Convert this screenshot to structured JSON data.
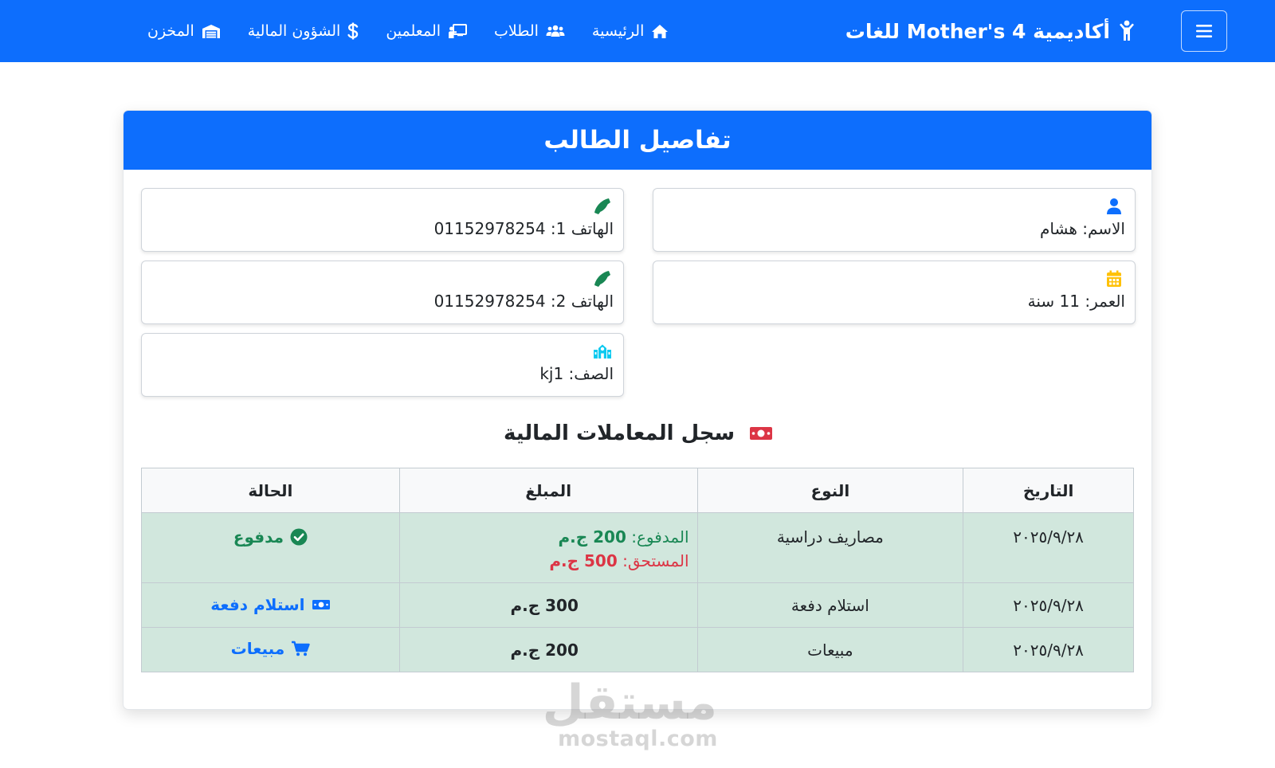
{
  "navbar": {
    "brand": "أكاديمية Mother's 4 للغات",
    "brand_icon": "child-icon",
    "links": [
      {
        "label": "الرئيسية",
        "icon": "home-icon"
      },
      {
        "label": "الطلاب",
        "icon": "users-icon"
      },
      {
        "label": "المعلمين",
        "icon": "chalkboard-teacher-icon"
      },
      {
        "label": "الشؤون المالية",
        "icon": "dollar-icon"
      },
      {
        "label": "المخزن",
        "icon": "warehouse-icon"
      }
    ],
    "toggler_icon": "hamburger-icon",
    "color": "#0d6efd"
  },
  "card": {
    "title": "تفاصيل الطالب",
    "fields": {
      "name": "الاسم: هشام",
      "age": "العمر: 11 سنة",
      "phone1": "الهاتف 1: 01152978254",
      "phone2": "الهاتف 2: 01152978254",
      "class": "الصف: kj1"
    },
    "field_icons": {
      "name": "user-icon",
      "age": "calendar-icon",
      "phone1": "phone-icon",
      "phone2": "phone-icon",
      "class": "school-icon"
    },
    "icon_colors": {
      "user": "#0d6efd",
      "calendar": "#ffc107",
      "phone": "#198754",
      "school": "#0dcaf0",
      "money": "#dc3545"
    }
  },
  "transactions": {
    "title": "سجل المعاملات المالية",
    "title_icon": "money-bill-icon",
    "headers": [
      "التاريخ",
      "النوع",
      "المبلغ",
      "الحالة"
    ],
    "rows": [
      {
        "date": "٢٠٢٥/٩/٢٨",
        "type": "مصاريف دراسية",
        "paid_label": "المدفوع:",
        "paid_value": "200 ج.م",
        "due_label": "المستحق:",
        "due_value": "500 ج.م",
        "status": "مدفوع",
        "status_icon": "check-circle-icon"
      },
      {
        "date": "٢٠٢٥/٩/٢٨",
        "type": "استلام دفعة",
        "amount": "300 ج.م",
        "status": "استلام دفعة",
        "status_icon": "money-bill-icon"
      },
      {
        "date": "٢٠٢٥/٩/٢٨",
        "type": "مبيعات",
        "amount": "200 ج.م",
        "status": "مبيعات",
        "status_icon": "cart-icon"
      }
    ],
    "row_bg": "#d1e7dd"
  },
  "watermark": {
    "arabic": "مستقل",
    "latin": "mostaql.com"
  }
}
